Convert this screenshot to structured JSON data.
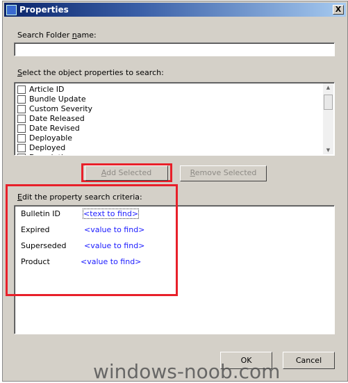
{
  "window": {
    "title": "Properties",
    "close_label": "X"
  },
  "folder_name": {
    "label_pre": "Search Folder ",
    "label_accel": "n",
    "label_post": "ame:",
    "value": ""
  },
  "properties": {
    "label_accel": "S",
    "label_post": "elect the object properties to search:",
    "items": [
      {
        "label": "Article ID",
        "checked": false
      },
      {
        "label": "Bundle Update",
        "checked": false
      },
      {
        "label": "Custom Severity",
        "checked": false
      },
      {
        "label": "Date Released",
        "checked": false
      },
      {
        "label": "Date Revised",
        "checked": false
      },
      {
        "label": "Deployable",
        "checked": false
      },
      {
        "label": "Deployed",
        "checked": false
      },
      {
        "label": "Description",
        "checked": false
      }
    ]
  },
  "buttons": {
    "add_accel": "A",
    "add_rest": "dd Selected",
    "remove_accel": "R",
    "remove_rest": "emove Selected",
    "ok": "OK",
    "cancel": "Cancel"
  },
  "criteria": {
    "label_accel": "E",
    "label_post": "dit the property search criteria:",
    "rows": [
      {
        "name": "Bulletin ID",
        "value": "<text to find>"
      },
      {
        "name": "Expired",
        "value": "<value to find>"
      },
      {
        "name": "Superseded",
        "value": "<value to find>"
      },
      {
        "name": "Product",
        "value": "<value to find>"
      }
    ]
  },
  "watermark": "windows-noob.com",
  "colors": {
    "highlight": "#e8202a",
    "link": "#1a1aff"
  }
}
